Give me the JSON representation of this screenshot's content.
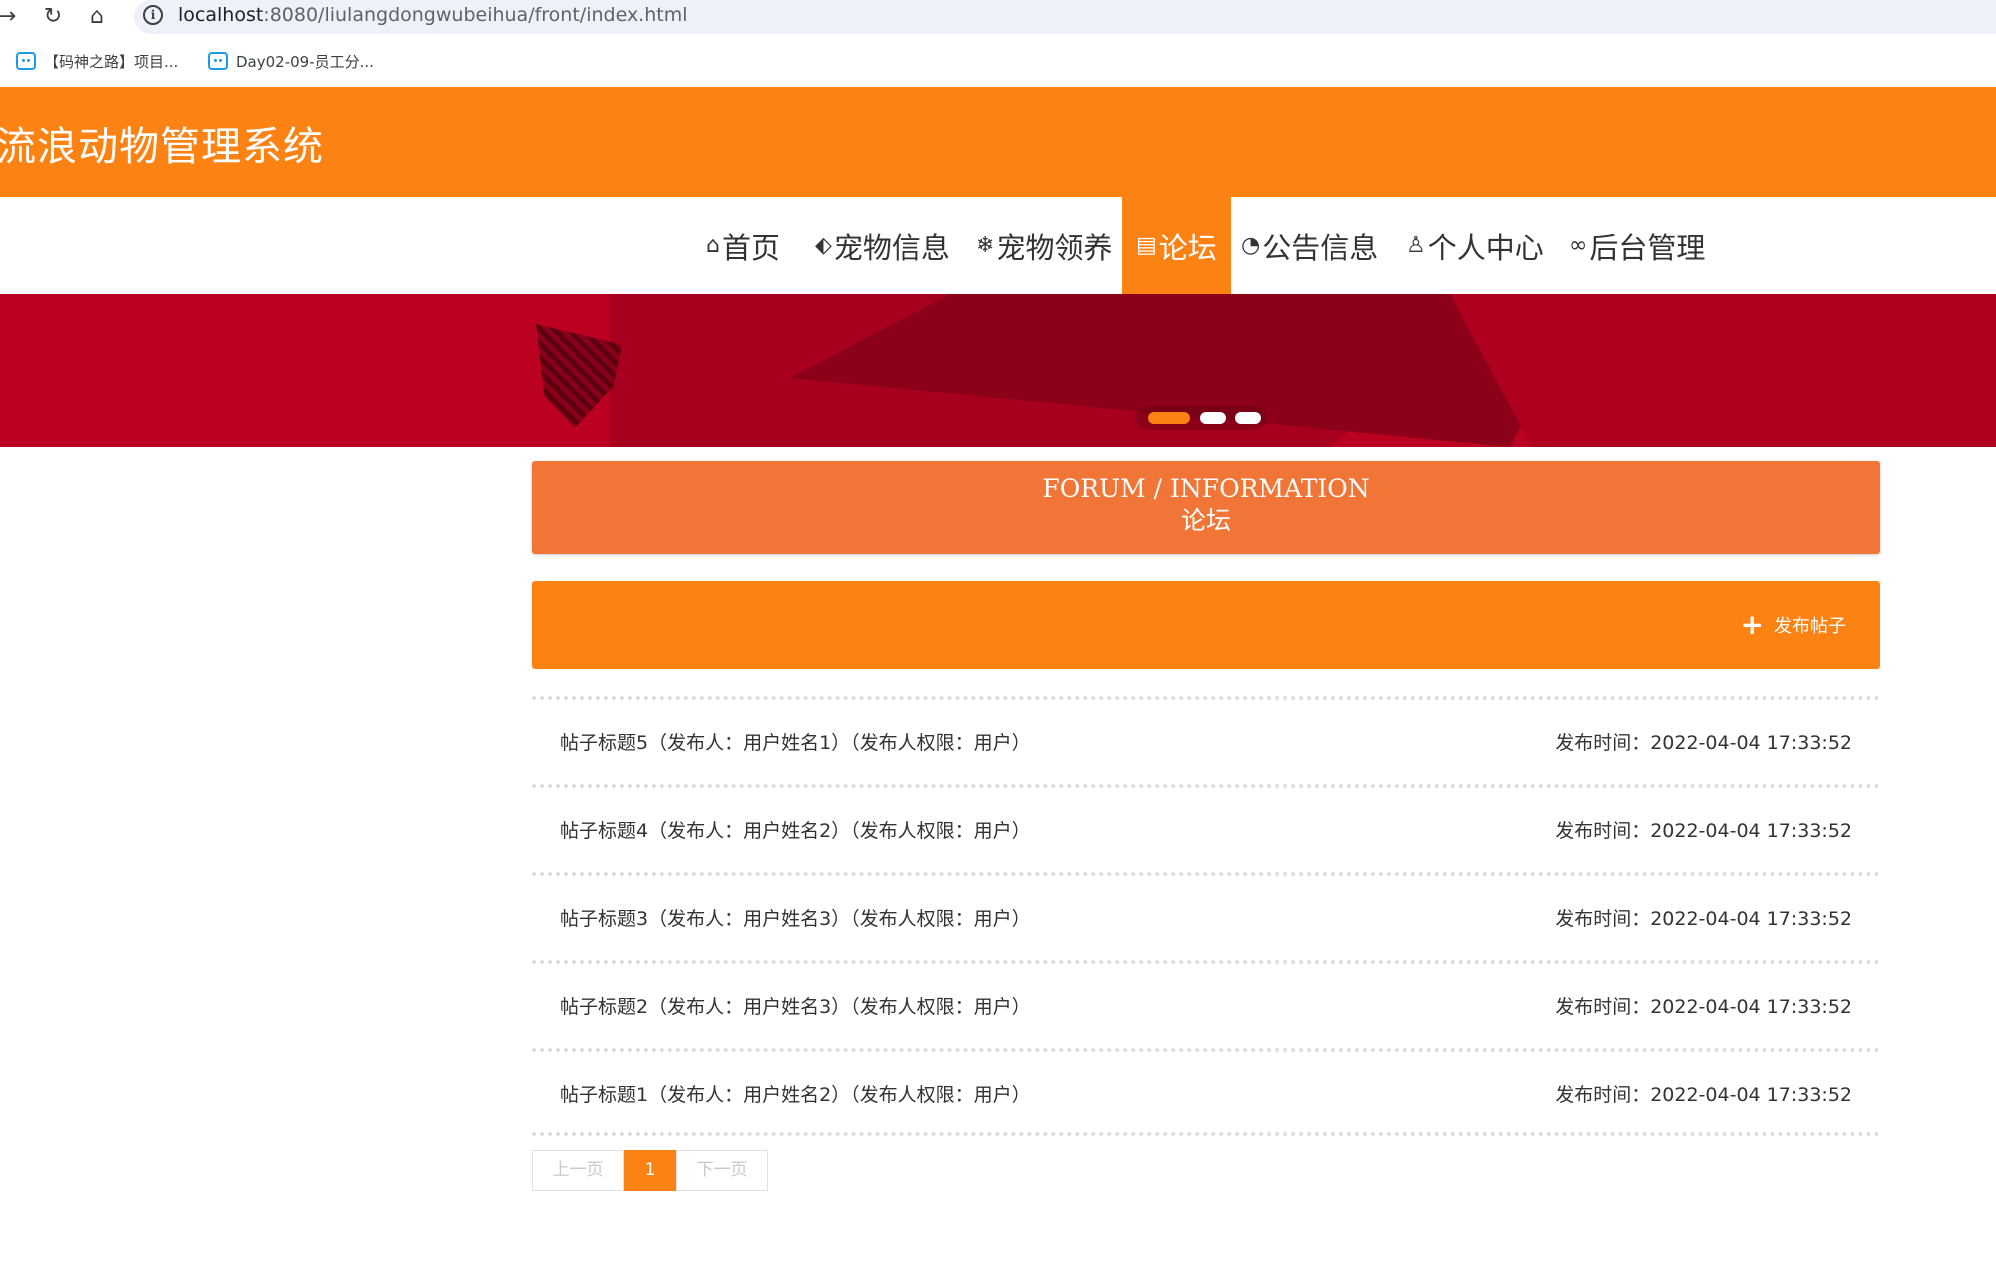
{
  "browser": {
    "url_host": "localhost",
    "url_path": ":8080/liulangdongwubeihua/front/index.html",
    "bookmarks": [
      {
        "label": "【码神之路】项目..."
      },
      {
        "label": "Day02-09-员工分..."
      }
    ]
  },
  "site": {
    "title": "流浪动物管理系统"
  },
  "nav": {
    "items": [
      {
        "label": "首页",
        "icon": "home-icon",
        "glyph": "⌂"
      },
      {
        "label": "宠物信息",
        "icon": "tag-icon",
        "glyph": "🏷"
      },
      {
        "label": "宠物领养",
        "icon": "snowflake-icon",
        "glyph": "❄"
      },
      {
        "label": "论坛",
        "icon": "clipboard-icon",
        "glyph": "📋",
        "active": true
      },
      {
        "label": "公告信息",
        "icon": "dashboard-icon",
        "glyph": "◔"
      },
      {
        "label": "个人中心",
        "icon": "user-icon",
        "glyph": "♙"
      },
      {
        "label": "后台管理",
        "icon": "link-icon",
        "glyph": "🔗"
      }
    ]
  },
  "carousel": {
    "slide_count": 3,
    "active_index": 0
  },
  "section": {
    "title_en": "FORUM / INFORMATION",
    "title_cn": "论坛"
  },
  "actions": {
    "add_post_label": "发布帖子"
  },
  "posts": [
    {
      "title": "帖子标题5（发布人：用户姓名1）（发布人权限：用户）",
      "time": "发布时间：2022-04-04 17:33:52"
    },
    {
      "title": "帖子标题4（发布人：用户姓名2）（发布人权限：用户）",
      "time": "发布时间：2022-04-04 17:33:52"
    },
    {
      "title": "帖子标题3（发布人：用户姓名3）（发布人权限：用户）",
      "time": "发布时间：2022-04-04 17:33:52"
    },
    {
      "title": "帖子标题2（发布人：用户姓名3）（发布人权限：用户）",
      "time": "发布时间：2022-04-04 17:33:52"
    },
    {
      "title": "帖子标题1（发布人：用户姓名2）（发布人权限：用户）",
      "time": "发布时间：2022-04-04 17:33:52"
    }
  ],
  "pagination": {
    "prev_label": "上一页",
    "current_page": "1",
    "next_label": "下一页"
  },
  "colors": {
    "primary": "#fc8214",
    "section_header": "#f07536",
    "banner": "#bc0022"
  }
}
